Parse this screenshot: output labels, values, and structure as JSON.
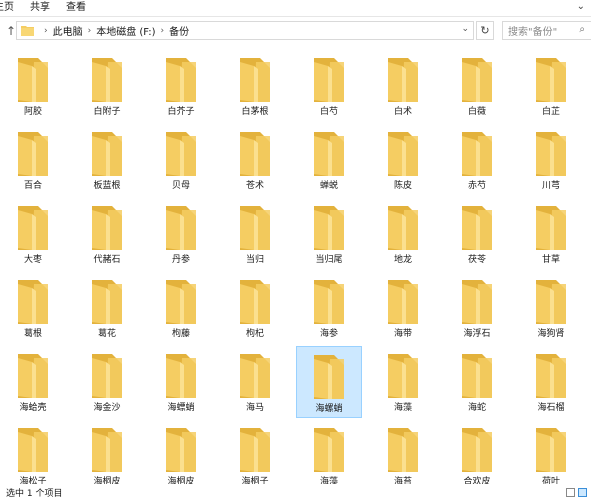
{
  "ribbon": {
    "tabs": [
      "主页",
      "共享",
      "查看"
    ]
  },
  "address": {
    "crumbs": [
      "此电脑",
      "本地磁盘 (F:)",
      "备份"
    ],
    "search_placeholder": "搜索\"备份\""
  },
  "folders": [
    "阿胶",
    "白附子",
    "白芥子",
    "白茅根",
    "白芍",
    "白术",
    "白薇",
    "白芷",
    "百合",
    "板蓝根",
    "贝母",
    "苍术",
    "蝉蜕",
    "陈皮",
    "赤芍",
    "川芎",
    "大枣",
    "代赭石",
    "丹参",
    "当归",
    "当归尾",
    "地龙",
    "茯苓",
    "甘草",
    "葛根",
    "葛花",
    "枸藤",
    "枸杞",
    "海参",
    "海带",
    "海浮石",
    "海狗肾",
    "海蛤壳",
    "海金沙",
    "海螵蛸",
    "海马",
    "海螺蛸",
    "海藻",
    "海蛇",
    "海石榴",
    "海松子",
    "海桐皮",
    "海桐皮",
    "海桐子",
    "海藻",
    "海苔",
    "合欢皮",
    "荷叶"
  ],
  "selected_index": 36,
  "status": {
    "text": "选中 1 个项目"
  },
  "colors": {
    "folder": "#f5cd62",
    "folder_dark": "#e3b23c",
    "selection": "#cce8ff"
  }
}
